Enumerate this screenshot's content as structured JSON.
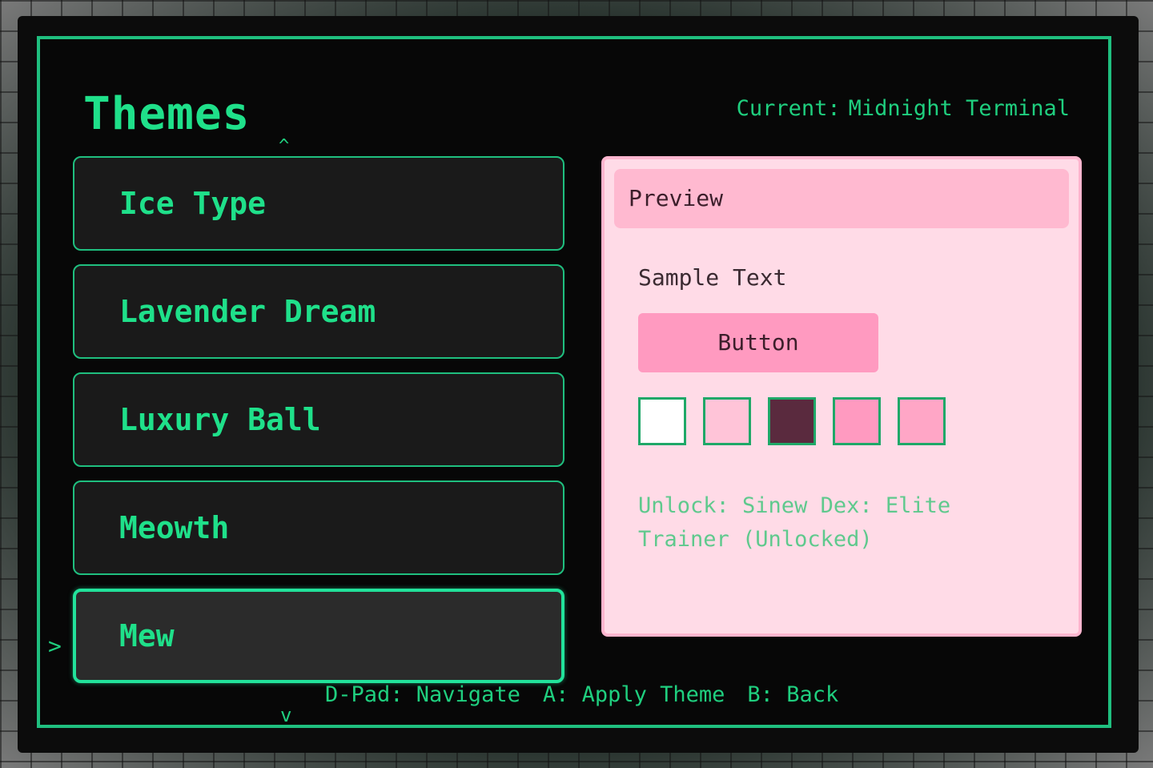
{
  "header": {
    "title": "Themes",
    "current_label": "Current:",
    "current_value": "Midnight Terminal"
  },
  "nav": {
    "up_arrow": "^",
    "down_arrow": "v",
    "cursor": ">"
  },
  "themes": [
    {
      "label": "Ice Type",
      "selected": false
    },
    {
      "label": "Lavender Dream",
      "selected": false
    },
    {
      "label": "Luxury Ball",
      "selected": false
    },
    {
      "label": "Meowth",
      "selected": false
    },
    {
      "label": "Mew",
      "selected": true
    }
  ],
  "preview": {
    "header": "Preview",
    "sample_text": "Sample Text",
    "button_label": "Button",
    "swatch_colors": [
      "#ffffff",
      "#ffc4d8",
      "#5a2a3e",
      "#ff9ac0",
      "#ffa6c6"
    ],
    "unlock_text": "Unlock: Sinew Dex: Elite Trainer (Unlocked)"
  },
  "footer": {
    "hint_navigate": "D-Pad: Navigate",
    "hint_apply": "A: Apply Theme",
    "hint_back": "B: Back"
  },
  "colors": {
    "accent": "#1fe08a",
    "border": "#1fbf7f",
    "preview_bg": "#ffdbe7",
    "preview_header": "#ffb9d0"
  }
}
